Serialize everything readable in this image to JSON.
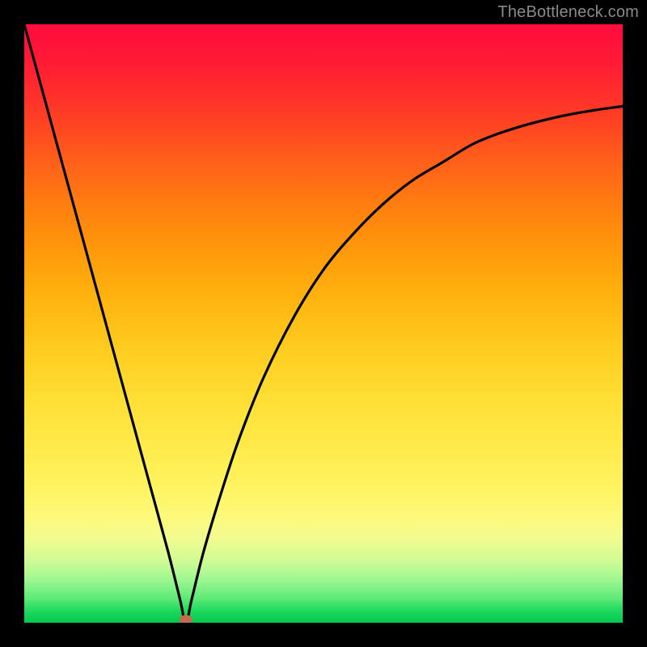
{
  "watermark": {
    "text": "TheBottleneck.com"
  },
  "chart_data": {
    "type": "line",
    "title": "",
    "xlabel": "",
    "ylabel": "",
    "xlim": [
      0,
      100
    ],
    "ylim": [
      0,
      100
    ],
    "grid": false,
    "legend": false,
    "marker": {
      "x": 27,
      "y": 0.5,
      "color": "#c46a52"
    },
    "series": [
      {
        "name": "bottleneck-curve",
        "color": "#000000",
        "x": [
          0,
          3,
          6,
          9,
          12,
          15,
          18,
          21,
          24,
          26,
          27,
          28,
          30,
          33,
          36,
          40,
          45,
          50,
          55,
          60,
          65,
          70,
          75,
          80,
          85,
          90,
          95,
          100
        ],
        "y": [
          100,
          89,
          78,
          67,
          56,
          45,
          34,
          23,
          12,
          4,
          0,
          4,
          12,
          22,
          31,
          41,
          51,
          59,
          65,
          70,
          74,
          77,
          80,
          82,
          83.5,
          84.7,
          85.6,
          86.3
        ]
      }
    ]
  }
}
